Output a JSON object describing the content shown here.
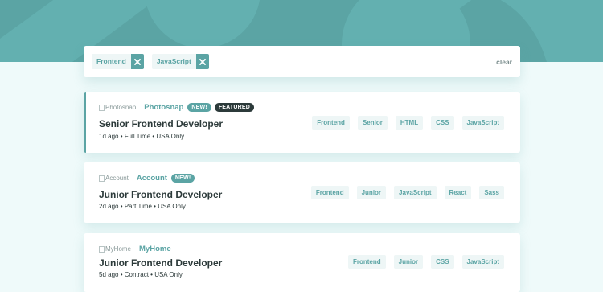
{
  "filters": {
    "chips": [
      {
        "label": "Frontend"
      },
      {
        "label": "JavaScript"
      }
    ],
    "clear_label": "clear"
  },
  "jobs": [
    {
      "company": "Photosnap",
      "logo_alt": "Photosnap",
      "new_badge": "NEW!",
      "featured_badge": "FEATURED",
      "position": "Senior Frontend Developer",
      "meta": "1d ago • Full Time • USA Only",
      "tags": [
        "Frontend",
        "Senior",
        "HTML",
        "CSS",
        "JavaScript"
      ]
    },
    {
      "company": "Account",
      "logo_alt": "Account",
      "new_badge": "NEW!",
      "position": "Junior Frontend Developer",
      "meta": "2d ago • Part Time • USA Only",
      "tags": [
        "Frontend",
        "Junior",
        "JavaScript",
        "React",
        "Sass"
      ]
    },
    {
      "company": "MyHome",
      "logo_alt": "MyHome",
      "position": "Junior Frontend Developer",
      "meta": "5d ago • Contract • USA Only",
      "tags": [
        "Frontend",
        "Junior",
        "CSS",
        "JavaScript"
      ]
    }
  ],
  "colors": {
    "accent": "#5ba4a4",
    "background": "#effafa",
    "tag_bg": "#eef6f6",
    "dark": "#2c3a3a"
  }
}
